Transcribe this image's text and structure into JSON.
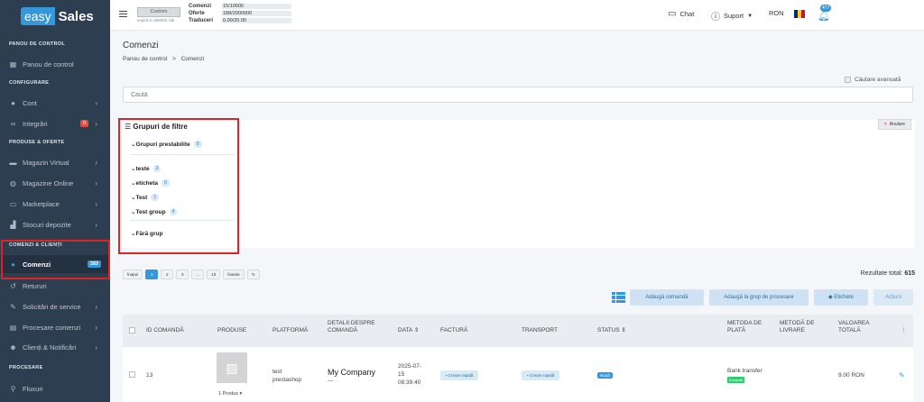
{
  "sidebar": {
    "logo_a": "easy",
    "logo_b": "Sales",
    "sections": [
      "PANOU DE CONTROL",
      "CONFIGURARE",
      "PRODUSE & OFERTE",
      "COMENZI & CLIENȚI",
      "PROCESARE"
    ],
    "items": [
      {
        "label": "Panou de control",
        "icon": "dashboard-icon"
      },
      {
        "label": "Cont",
        "icon": "user-icon"
      },
      {
        "label": "Integrări",
        "icon": "link-icon",
        "badge": "0"
      },
      {
        "label": "Magazin Virtual",
        "icon": "store-icon"
      },
      {
        "label": "Magazine Online",
        "icon": "globe-icon"
      },
      {
        "label": "Marketplace",
        "icon": "marketplace-icon"
      },
      {
        "label": "Stocuri depozite",
        "icon": "warehouse-icon"
      },
      {
        "label": "Comenzi",
        "icon": "orders-icon",
        "badge": "283"
      },
      {
        "label": "Retururi",
        "icon": "return-icon"
      },
      {
        "label": "Solicitări de service",
        "icon": "wrench-icon"
      },
      {
        "label": "Procesare comenzi",
        "icon": "process-icon"
      },
      {
        "label": "Clienți & Notificări",
        "icon": "users-icon"
      },
      {
        "label": "Fluxuri",
        "icon": "flow-icon"
      }
    ]
  },
  "topbar": {
    "plan_label": "Custom",
    "plan_expiry": "expiră in 356093 zile",
    "quotas": [
      {
        "label": "Comenzi",
        "value": "15/10000"
      },
      {
        "label": "Oferte",
        "value": "188/2000000"
      },
      {
        "label": "Traduceri",
        "value": "0.00/20.00"
      }
    ],
    "chat": "Chat",
    "support": "Suport",
    "currency": "RON",
    "notif_count": "477"
  },
  "page": {
    "title": "Comenzi",
    "breadcrumb_home": "Panou de control",
    "breadcrumb_sep": ">",
    "breadcrumb_current": "Comenzi",
    "advanced_search": "Căutare avansată",
    "search_placeholder": "Caută"
  },
  "filters": {
    "title": "Grupuri de filtre",
    "cancel": "Anulare",
    "groups": [
      {
        "label": "Grupuri prestabilite",
        "count": "9"
      },
      {
        "label": "teste",
        "count": "3"
      },
      {
        "label": "eticheta",
        "count": "0"
      },
      {
        "label": "Test",
        "count": "1"
      },
      {
        "label": "Test group",
        "count": "4"
      },
      {
        "label": "Fără grup",
        "count": ""
      }
    ]
  },
  "pagination": {
    "prev": "Înapoi",
    "pages": [
      "1",
      "2",
      "3",
      "...",
      "13"
    ],
    "next": "Înainte",
    "refresh": "↻",
    "total_label": "Rezultate total:",
    "total_value": "615"
  },
  "actions": {
    "add_order": "Adaugă comandă",
    "add_to_group": "Adaugă la grup de procesare",
    "labels": "Etichete",
    "actions": "Acțiuni"
  },
  "table": {
    "columns": [
      "ID COMANDĂ",
      "PRODUSE",
      "PLATFORMĂ",
      "DETALII DESPRE COMANDĂ",
      "DATA",
      "FACTURĂ",
      "TRANSPORT",
      "STATUS",
      "METODA DE PLATĂ",
      "METODĂ DE LIVRARE",
      "VALOAREA TOTALĂ"
    ],
    "rows": [
      {
        "id": "13",
        "products": "1 Produs",
        "platform_a": "test",
        "platform_b": "prestashop",
        "company": "My Company",
        "company_sub": "---",
        "date_a": "2025-07-",
        "date_b": "15",
        "date_c": "08:39:40",
        "invoice": "Creare rapidă",
        "transport": "Creare rapidă",
        "status": "Nouă",
        "payment": "Bank transfer",
        "payment_status": "Încasată",
        "delivery": "",
        "total": "9.00 RON"
      }
    ]
  }
}
